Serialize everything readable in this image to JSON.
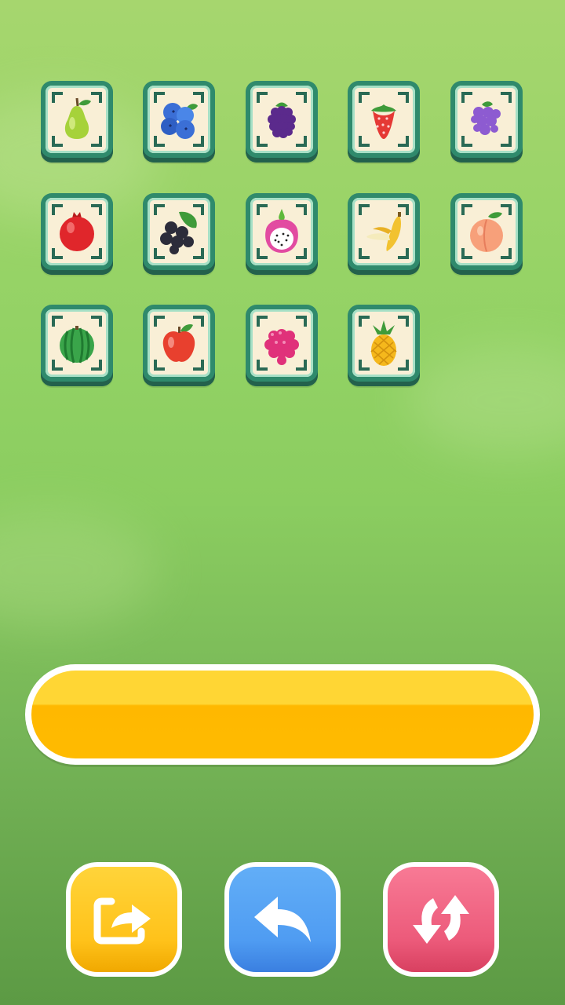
{
  "board": {
    "tiles": [
      {
        "fruit": "pear-icon"
      },
      {
        "fruit": "blueberry-icon"
      },
      {
        "fruit": "blackberry-icon"
      },
      {
        "fruit": "strawberry-icon"
      },
      {
        "fruit": "grapes-icon"
      },
      {
        "fruit": "pomegranate-icon"
      },
      {
        "fruit": "blackcurrant-icon"
      },
      {
        "fruit": "dragonfruit-icon"
      },
      {
        "fruit": "banana-icon"
      },
      {
        "fruit": "peach-icon"
      },
      {
        "fruit": "watermelon-icon"
      },
      {
        "fruit": "apple-icon"
      },
      {
        "fruit": "raspberry-icon"
      },
      {
        "fruit": "pineapple-icon"
      }
    ]
  },
  "tray": {
    "slots_filled": 0
  },
  "tools": [
    {
      "name": "move-out-button",
      "icon": "move-out-icon",
      "color": "#ffc21a"
    },
    {
      "name": "undo-button",
      "icon": "undo-arrow-icon",
      "color": "#4f9cf2"
    },
    {
      "name": "shuffle-button",
      "icon": "shuffle-icon",
      "color": "#ec5a7a"
    }
  ]
}
